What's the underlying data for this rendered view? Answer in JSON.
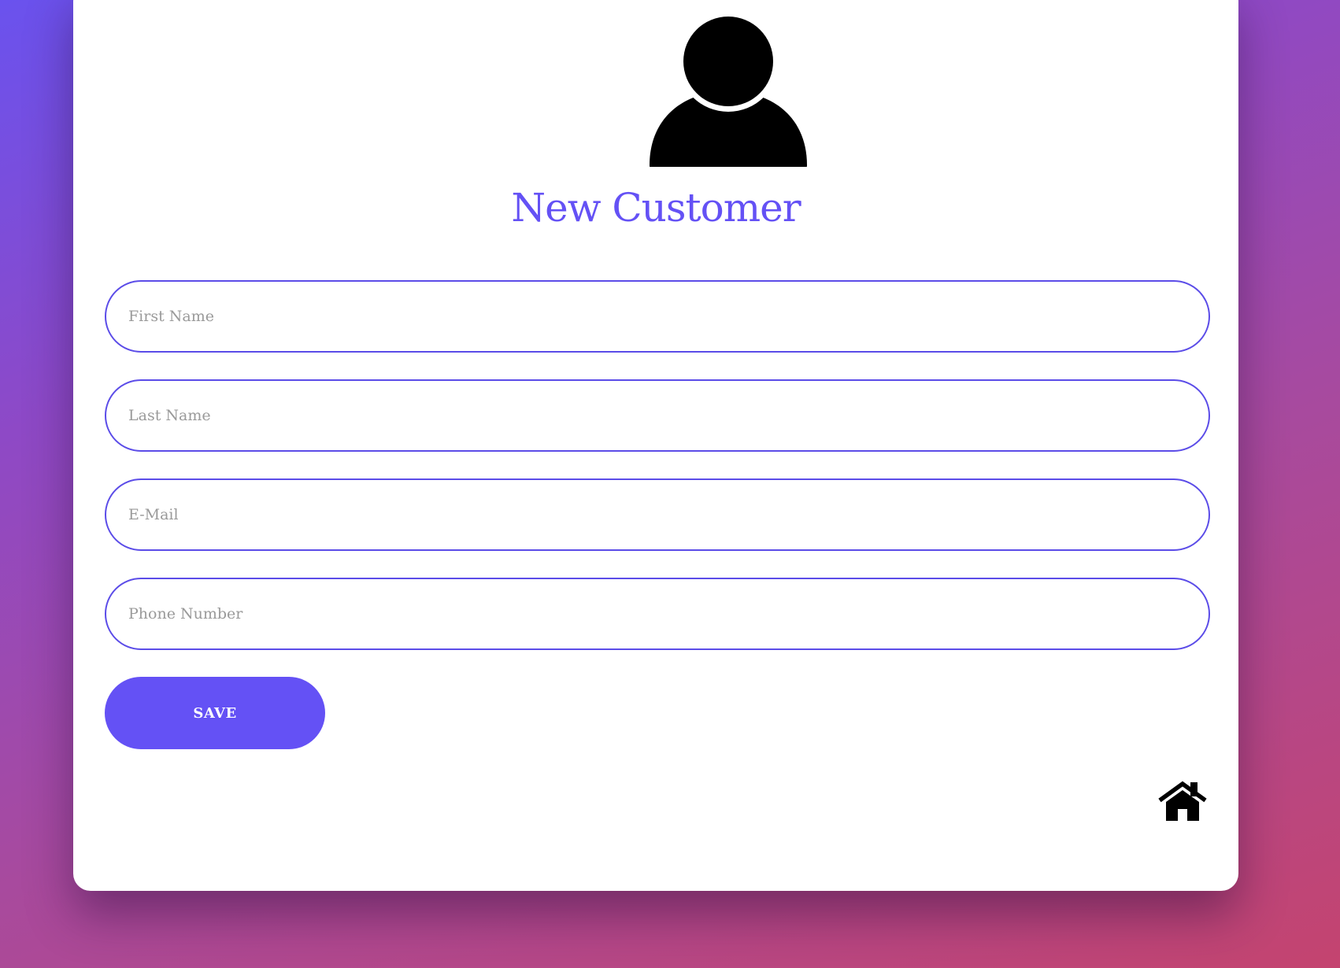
{
  "form": {
    "title": "New Customer",
    "fields": [
      {
        "placeholder": "First Name",
        "value": ""
      },
      {
        "placeholder": "Last Name",
        "value": ""
      },
      {
        "placeholder": "E-Mail",
        "value": ""
      },
      {
        "placeholder": "Phone Number",
        "value": ""
      }
    ],
    "save_label": "SAVE"
  },
  "icons": {
    "avatar": "user-icon",
    "home": "home-icon"
  },
  "colors": {
    "accent": "#6451f5",
    "field_border": "#5b4ce8",
    "placeholder": "#9a9a9a",
    "card": "#ffffff"
  }
}
